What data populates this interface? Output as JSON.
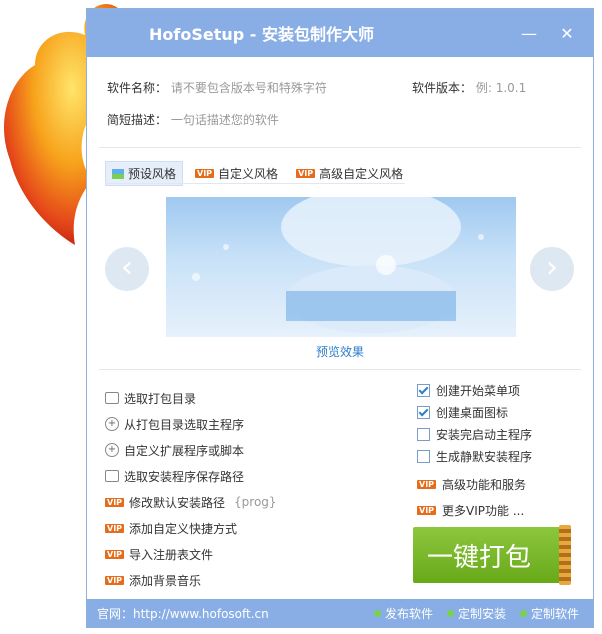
{
  "window": {
    "title": "HofoSetup - 安装包制作大师",
    "minimize_icon": "minimize-icon",
    "close_icon": "close-icon"
  },
  "fields": {
    "name_label": "软件名称：",
    "name_placeholder": "请不要包含版本号和特殊字符",
    "version_label": "软件版本：",
    "version_placeholder": "例: 1.0.1",
    "desc_label": "简短描述：",
    "desc_placeholder": "一句话描述您的软件"
  },
  "tabs": [
    {
      "label": "预设风格",
      "vip": false
    },
    {
      "label": "自定义风格",
      "vip": true
    },
    {
      "label": "高级自定义风格",
      "vip": true
    }
  ],
  "preview": {
    "caption": "预览效果"
  },
  "options": [
    {
      "label": "选取打包目录",
      "icon": "folder-add-icon",
      "vip": false
    },
    {
      "label": "从打包目录选取主程序",
      "icon": "add-circle-icon",
      "vip": false
    },
    {
      "label": "自定义扩展程序或脚本",
      "icon": "add-circle-icon",
      "vip": false
    },
    {
      "label": "选取安装程序保存路径",
      "icon": "folder-add-icon",
      "vip": false
    },
    {
      "label": "修改默认安装路径",
      "suffix": "{prog}",
      "vip": true
    },
    {
      "label": "添加自定义快捷方式",
      "vip": true
    },
    {
      "label": "导入注册表文件",
      "vip": true
    },
    {
      "label": "添加背景音乐",
      "vip": true
    }
  ],
  "checks": [
    {
      "label": "创建开始菜单项",
      "checked": true
    },
    {
      "label": "创建桌面图标",
      "checked": true
    },
    {
      "label": "安装完启动主程序",
      "checked": false
    },
    {
      "label": "生成静默安装程序",
      "checked": false
    }
  ],
  "vip_links": [
    {
      "label": "高级功能和服务"
    },
    {
      "label": "更多VIP功能 ..."
    }
  ],
  "vip_badge": "VIP",
  "build_button": "一键打包",
  "footer": {
    "site": "官网：http://www.hofosoft.cn",
    "links": [
      "发布软件",
      "定制安装",
      "定制软件"
    ]
  },
  "colors": {
    "titlebar": "#89aee6",
    "accent": "#2f7ec8",
    "build": "#7cb82f",
    "vip": "#e56c1a"
  }
}
